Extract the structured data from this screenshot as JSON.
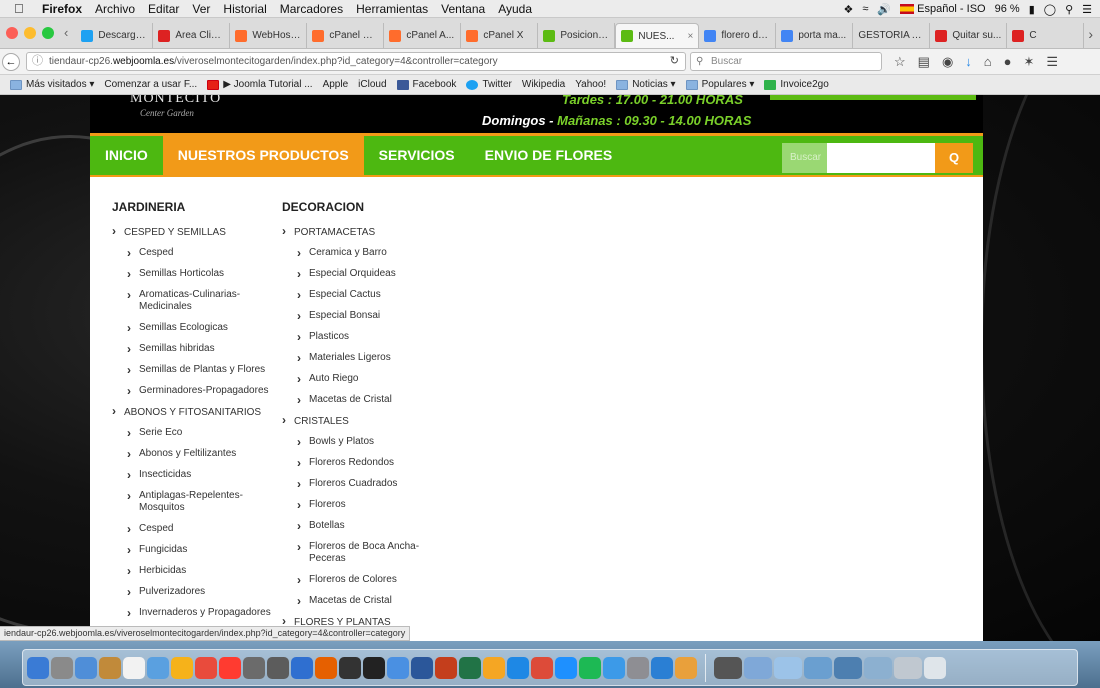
{
  "menubar": {
    "app": "Firefox",
    "items": [
      "Archivo",
      "Editar",
      "Ver",
      "Historial",
      "Marcadores",
      "Herramientas",
      "Ventana",
      "Ayuda"
    ],
    "input_source": "Español - ISO",
    "battery": "96 %"
  },
  "tabs": [
    {
      "label": "Descarga...",
      "icon": "twitter-icon",
      "color": "#1da1f2"
    },
    {
      "label": "Área Clie...",
      "icon": "w-icon",
      "color": "#d22"
    },
    {
      "label": "WebHost...",
      "icon": "cpanel-icon",
      "color": "#ff6c2c"
    },
    {
      "label": "cPanel X ...",
      "icon": "cpanel-icon",
      "color": "#ff6c2c"
    },
    {
      "label": "cPanel A...",
      "icon": "cpanel-icon",
      "color": "#ff6c2c"
    },
    {
      "label": "cPanel X",
      "icon": "cpanel-icon",
      "color": "#ff6c2c"
    },
    {
      "label": "Posicione...",
      "icon": "leaf-icon",
      "color": "#5cbb13"
    },
    {
      "label": "NUES...",
      "icon": "leaf-icon",
      "color": "#5cbb13",
      "active": true
    },
    {
      "label": "florero de...",
      "icon": "google-icon",
      "color": "#4285f4"
    },
    {
      "label": "porta ma...",
      "icon": "google-icon",
      "color": "#4285f4"
    },
    {
      "label": "GESTORIA AS...",
      "icon": "",
      "color": ""
    },
    {
      "label": "Quitar su...",
      "icon": "w-icon",
      "color": "#d22"
    },
    {
      "label": "C",
      "icon": "w-icon",
      "color": "#d22"
    }
  ],
  "navbar": {
    "url_prefix": "tiendaur-cp26.",
    "url_host": "webjoomla.es",
    "url_path": "/viveroselmontecitogarden/index.php?id_category=4&controller=category",
    "search_placeholder": "Buscar"
  },
  "bookmarks": [
    {
      "label": "Más visitados ▾",
      "icon": "folder"
    },
    {
      "label": "Comenzar a usar F...",
      "icon": "page"
    },
    {
      "label": "▶ Joomla Tutorial ...",
      "icon": "yt"
    },
    {
      "label": "Apple",
      "icon": "page"
    },
    {
      "label": "iCloud",
      "icon": "page"
    },
    {
      "label": "Facebook",
      "icon": "fb"
    },
    {
      "label": "Twitter",
      "icon": "tw"
    },
    {
      "label": "Wikipedia",
      "icon": "page"
    },
    {
      "label": "Yahoo!",
      "icon": "page"
    },
    {
      "label": "Noticias ▾",
      "icon": "folder"
    },
    {
      "label": "Populares ▾",
      "icon": "folder"
    },
    {
      "label": "Invoice2go",
      "icon": "i2g"
    }
  ],
  "site": {
    "logo": "MONTECITO",
    "logo_sub": "Center Garden",
    "hours_line1": "Tardes : 17.00 - 21.00 HORAS",
    "hours_weekday": "Domingos - ",
    "hours_line2": "Mañanas : 09.30 - 14.00 HORAS",
    "nav": [
      "INICIO",
      "NUESTROS PRODUCTOS",
      "SERVICIOS",
      "ENVIO DE FLORES"
    ],
    "search_label": "Buscar",
    "search_button": "Q"
  },
  "dropdown": {
    "jardineria": {
      "title": "JARDINERIA",
      "groups": [
        {
          "name": "CESPED Y SEMILLAS",
          "items": [
            "Cesped",
            "Semillas Horticolas",
            "Aromaticas-Culinarias-Medicinales",
            "Semillas Ecologicas",
            "Semillas hibridas",
            "Semillas de Plantas y Flores",
            "Germinadores-Propagadores"
          ]
        },
        {
          "name": "ABONOS Y FITOSANITARIOS",
          "items": [
            "Serie Eco",
            "Abonos y Feltilizantes",
            "Insecticidas",
            "Antiplagas-Repelentes-Mosquitos",
            "Cesped",
            "Fungicidas",
            "Herbicidas",
            "Pulverizadores",
            "Invernaderos y Propagadores"
          ]
        }
      ]
    },
    "decoracion": {
      "title": "DECORACION",
      "groups": [
        {
          "name": "PORTAMACETAS",
          "items": [
            "Ceramica y Barro",
            "Especial Orquideas",
            "Especial Cactus",
            "Especial Bonsai",
            "Plasticos",
            "Materiales Ligeros",
            "Auto Riego",
            "Macetas de Cristal"
          ]
        },
        {
          "name": "CRISTALES",
          "items": [
            "Bowls y Platos",
            "Floreros Redondos",
            "Floreros Cuadrados",
            "Floreros",
            "Botellas",
            "Floreros de Boca Ancha-Peceras",
            "Floreros de Colores",
            "Macetas de Cristal"
          ]
        },
        {
          "name": "FLORES Y PLANTAS",
          "items": []
        }
      ]
    }
  },
  "status_url": "iendaur-cp26.webjoomla.es/viveroselmontecitogarden/index.php?id_category=4&controller=category",
  "colors": {
    "green": "#4db811",
    "orange": "#f29a18"
  }
}
